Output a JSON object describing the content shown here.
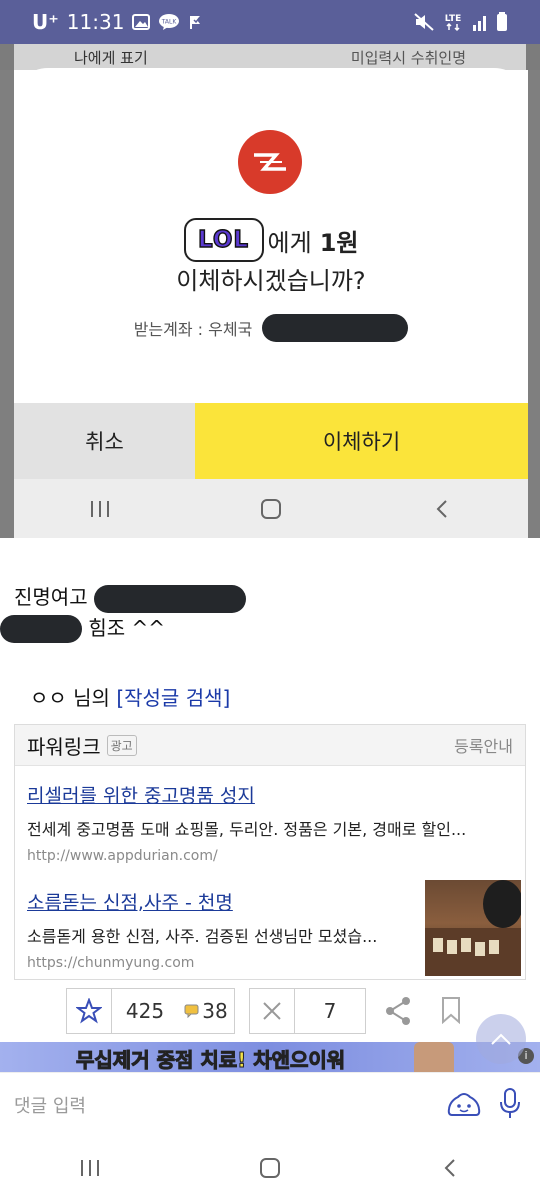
{
  "status_bar": {
    "carrier": "U⁺",
    "time": "11:31",
    "talk_badge": "TALK",
    "network": "LTE"
  },
  "background": {
    "row_left": "나에게 표기",
    "row_right": "미입력시 수취인명"
  },
  "dialog": {
    "recipient_badge": "LOL",
    "line1_suffix": "에게",
    "amount": "1원",
    "line2": "이체하시겠습니까?",
    "account_label": "받는계좌 : 우체국",
    "cancel_label": "취소",
    "confirm_label": "이체하기"
  },
  "post": {
    "line1_prefix": "진명여고 ",
    "line2_suffix": " 힘조 ^^",
    "author": "ㅇㅇ 님의",
    "search_link": "[작성글 검색]"
  },
  "powerlink": {
    "title": "파워링크",
    "ad_tag": "광고",
    "register": "등록안내",
    "ads": [
      {
        "title": "리셀러를 위한 중고명품 성지",
        "desc": "전세계 중고명품 도매 쇼핑몰, 두리안. 정품은 기본, 경매로 할인...",
        "url": "http://www.appdurian.com/"
      },
      {
        "title": "소름돋는 신점,사주 - 천명",
        "desc": "소름돋게 용한 신점, 사주. 검증된 선생님만 모셨습...",
        "url": "https://chunmyung.com"
      }
    ]
  },
  "actions": {
    "recommend_count": "425",
    "comment_count": "38",
    "dislike_count": "7"
  },
  "banner": {
    "text": "무십제거 중점 치료! 차앤으이워"
  },
  "comment": {
    "placeholder": "댓글 입력"
  },
  "colors": {
    "status_bar": "#5a5f99",
    "confirm_yellow": "#fbe43a",
    "cancel_gray": "#e2e2e2",
    "link_blue": "#1b3a99",
    "app_red": "#d83a2a"
  }
}
